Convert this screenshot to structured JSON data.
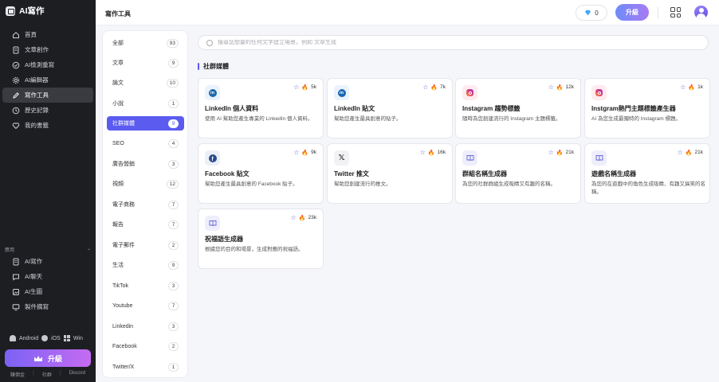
{
  "app": {
    "name": "AI寫作"
  },
  "sidebar": {
    "nav": [
      {
        "label": "首頁",
        "icon": "home-icon"
      },
      {
        "label": "文章創作",
        "icon": "document-icon"
      },
      {
        "label": "AI檢測重寫",
        "icon": "check-circle-icon"
      },
      {
        "label": "AI編輯器",
        "icon": "gear-icon"
      },
      {
        "label": "寫作工具",
        "icon": "pen-icon",
        "active": true
      },
      {
        "label": "歷史記錄",
        "icon": "clock-icon"
      },
      {
        "label": "我的書籤",
        "icon": "heart-icon"
      }
    ],
    "apps_header": "應用",
    "apps": [
      {
        "label": "AI寫作",
        "icon": "document-icon"
      },
      {
        "label": "AI聊天",
        "icon": "chat-icon"
      },
      {
        "label": "AI生圖",
        "icon": "image-icon"
      },
      {
        "label": "製件摘寫",
        "icon": "monitor-icon"
      }
    ],
    "platforms": [
      "Android",
      "iOS",
      "Win"
    ],
    "upgrade_label": "升級",
    "footer_links": [
      "賺佣金",
      "社群",
      "Discord"
    ]
  },
  "header": {
    "page_title": "寫作工具",
    "gems": "0",
    "upgrade_label": "升級"
  },
  "categories": [
    {
      "label": "全部",
      "count": "93"
    },
    {
      "label": "文章",
      "count": "9"
    },
    {
      "label": "論文",
      "count": "10"
    },
    {
      "label": "小說",
      "count": "1"
    },
    {
      "label": "社群媒體",
      "count": "9",
      "active": true
    },
    {
      "label": "SEO",
      "count": "4"
    },
    {
      "label": "廣告營銷",
      "count": "3"
    },
    {
      "label": "視頻",
      "count": "12"
    },
    {
      "label": "電子商務",
      "count": "7"
    },
    {
      "label": "報告",
      "count": "7"
    },
    {
      "label": "電子郵件",
      "count": "2"
    },
    {
      "label": "生活",
      "count": "9"
    },
    {
      "label": "TikTok",
      "count": "3"
    },
    {
      "label": "Youtube",
      "count": "7"
    },
    {
      "label": "Linkedin",
      "count": "3"
    },
    {
      "label": "Facebook",
      "count": "2"
    },
    {
      "label": "Twitter/X",
      "count": "1"
    }
  ],
  "search": {
    "placeholder": "搜尋您想要的任何文字建立場景，例如 文章生成"
  },
  "section_title": "社群媒體",
  "tools": [
    {
      "title": "LinkedIn 個人資料",
      "desc": "使用 AI 幫助您產生專業的 LinkedIn 個人資料。",
      "uses": "5k",
      "icon": "linkedin-icon",
      "icon_bg": "#eaf2fb"
    },
    {
      "title": "LinkedIn 貼文",
      "desc": "幫助您產生最具創意的貼子。",
      "uses": "7k",
      "icon": "linkedin-icon",
      "icon_bg": "#eaf2fb"
    },
    {
      "title": "Instagram 趨勢標籤",
      "desc": "隨時為您創建流行的 Instagram 主題標籤。",
      "uses": "12k",
      "icon": "instagram-icon",
      "icon_bg": "#fdecef"
    },
    {
      "title": "Instgram熱門主題標籤產生器",
      "desc": "AI 為您生成最獨特的 Instagram 標題。",
      "uses": "1k",
      "icon": "instagram-icon",
      "icon_bg": "#fdecef"
    },
    {
      "title": "Facebook 貼文",
      "desc": "幫助您產生最具創意的 Facebook 貼子。",
      "uses": "9k",
      "icon": "facebook-icon",
      "icon_bg": "#ebeff7"
    },
    {
      "title": "Twitter 推文",
      "desc": "幫助您創建流行的推文。",
      "uses": "16k",
      "icon": "x-icon",
      "icon_bg": "#f2f2f4"
    },
    {
      "title": "群組名稱生成器",
      "desc": "為您的社群群組生成吸睛又有趣的名稱。",
      "uses": "21k",
      "icon": "book-icon",
      "icon_bg": "#eeeefc"
    },
    {
      "title": "遊戲名稱生成器",
      "desc": "為您的在遊戲中的角色生成吸睛、有趣又搞笑的名稱。",
      "uses": "21k",
      "icon": "book-icon",
      "icon_bg": "#eeeefc"
    },
    {
      "title": "祝福語生成器",
      "desc": "根據您的目的和場景，生成對應的祝福語。",
      "uses": "23k",
      "icon": "book-icon",
      "icon_bg": "#eeeefc"
    }
  ],
  "colors": {
    "accent": "#5b5bf0",
    "sidebar_bg": "#1d1e22",
    "fire": "#f0852a"
  }
}
